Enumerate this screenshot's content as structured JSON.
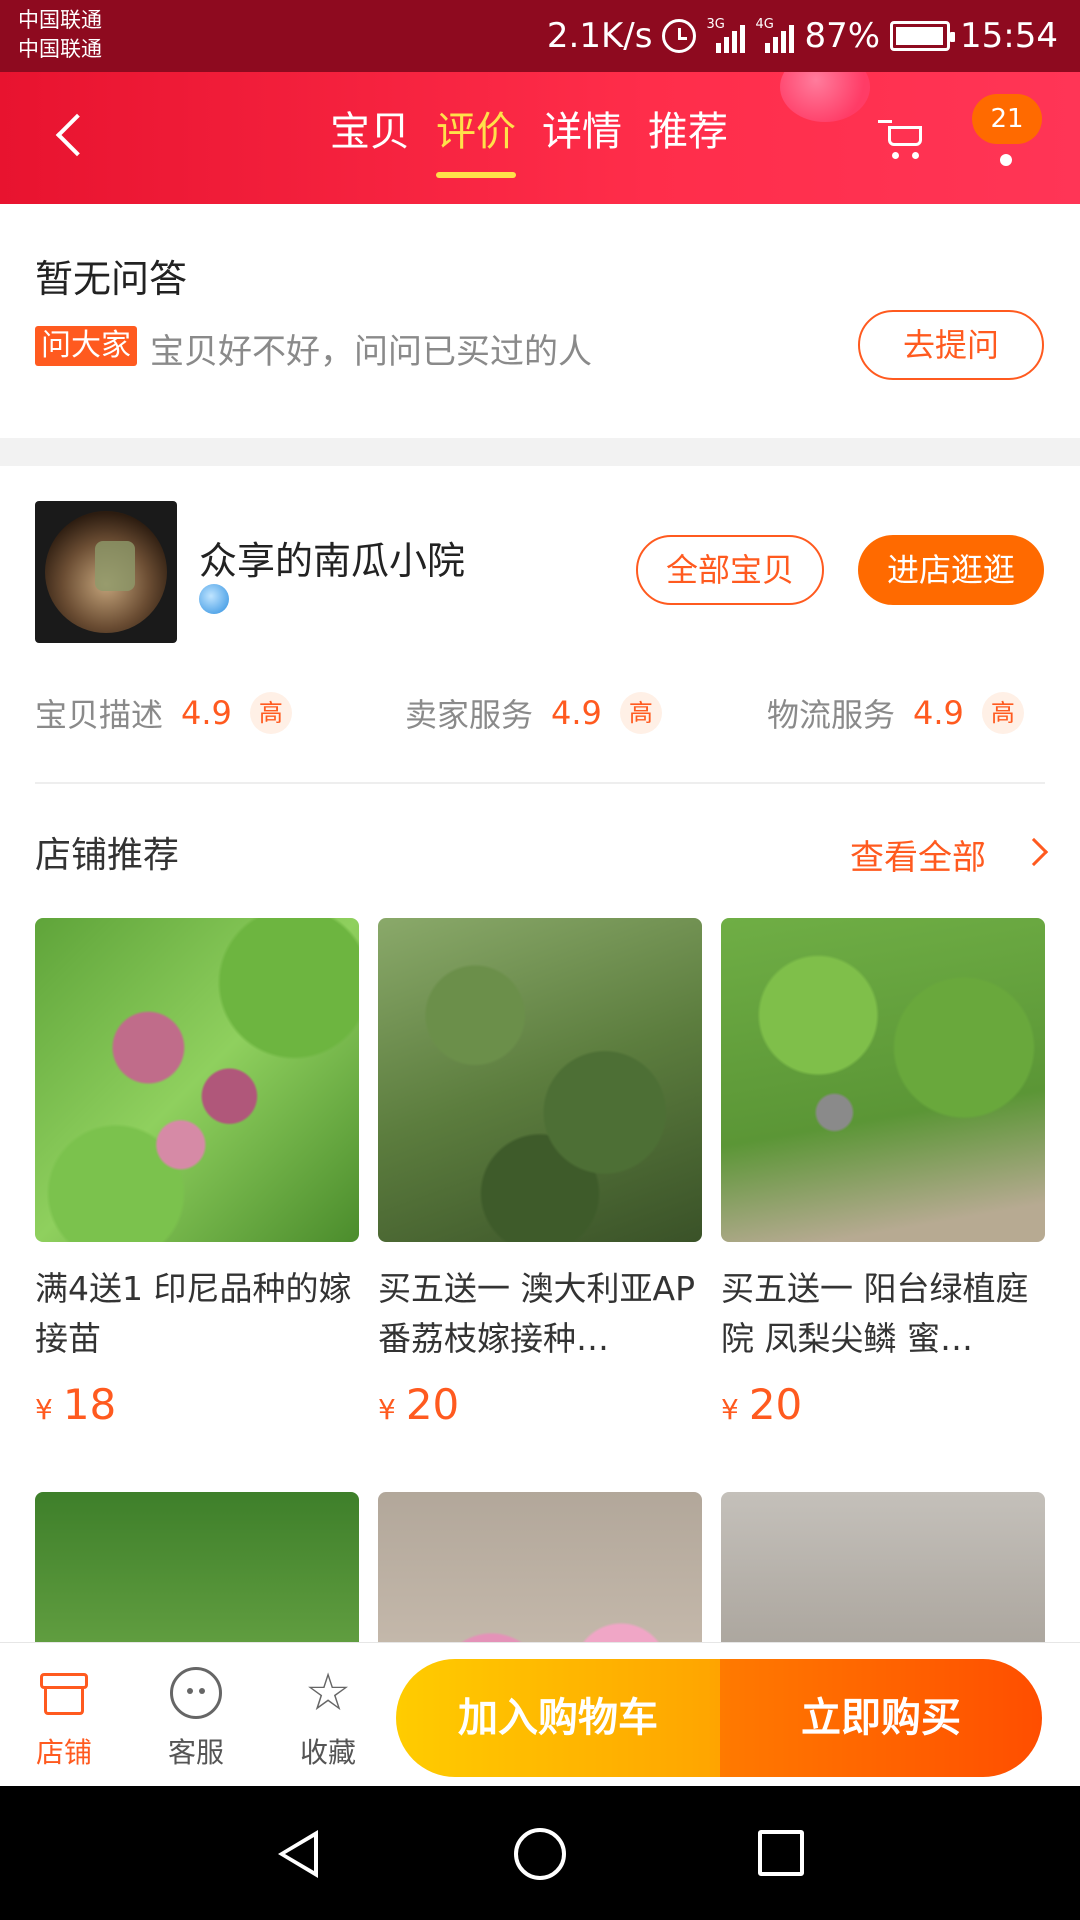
{
  "status_bar": {
    "carrier_1": "中国联通",
    "carrier_2": "中国联通",
    "net_speed": "2.1K/s",
    "sig_3g": "3G",
    "sig_4g": "4G",
    "battery": "87%",
    "time": "15:54"
  },
  "header": {
    "tabs": [
      {
        "label": "宝贝",
        "active": false
      },
      {
        "label": "评价",
        "active": true
      },
      {
        "label": "详情",
        "active": false
      },
      {
        "label": "推荐",
        "active": false
      }
    ],
    "cart_badge": "21",
    "accent": "#e8132f"
  },
  "qa": {
    "title": "暂无问答",
    "tag": "问大家",
    "hint": "宝贝好不好，问问已买过的人",
    "ask_button": "去提问"
  },
  "shop": {
    "name": "众享的南瓜小院",
    "all_items_button": "全部宝贝",
    "enter_shop_button": "进店逛逛",
    "ratings": [
      {
        "label": "宝贝描述",
        "value": "4.9",
        "level": "高"
      },
      {
        "label": "卖家服务",
        "value": "4.9",
        "level": "高"
      },
      {
        "label": "物流服务",
        "value": "4.9",
        "level": "高"
      }
    ]
  },
  "recommend": {
    "title": "店铺推荐",
    "see_all": "查看全部",
    "products": [
      {
        "name": "满4送1  印尼品种的嫁接苗",
        "currency": "¥",
        "price": "18"
      },
      {
        "name": "买五送一  澳大利亚AP番荔枝嫁接种…",
        "currency": "¥",
        "price": "20"
      },
      {
        "name": "买五送一 阳台绿植庭院 凤梨尖鳞 蜜…",
        "currency": "¥",
        "price": "20"
      }
    ]
  },
  "bottom_bar": {
    "items": [
      {
        "label": "店铺",
        "icon": "store-icon"
      },
      {
        "label": "客服",
        "icon": "service-icon"
      },
      {
        "label": "收藏",
        "icon": "star-icon"
      }
    ],
    "add_to_cart": "加入购物车",
    "buy_now": "立即购买"
  },
  "colors": {
    "accent_orange": "#ff5a1f",
    "header_red": "#e8132f"
  }
}
